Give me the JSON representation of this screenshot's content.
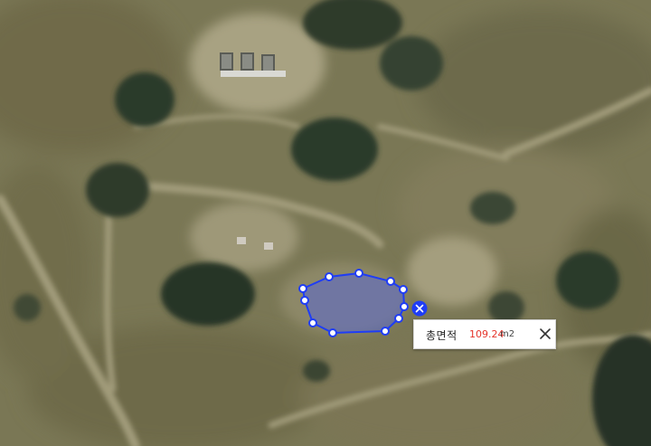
{
  "measure": {
    "label": "총면적",
    "value": "109.24",
    "unit": "m2",
    "accent_color": "#1f3df5",
    "value_color": "#e5332a",
    "close_icon": "close-icon",
    "delete_icon": "delete-shape-icon"
  }
}
